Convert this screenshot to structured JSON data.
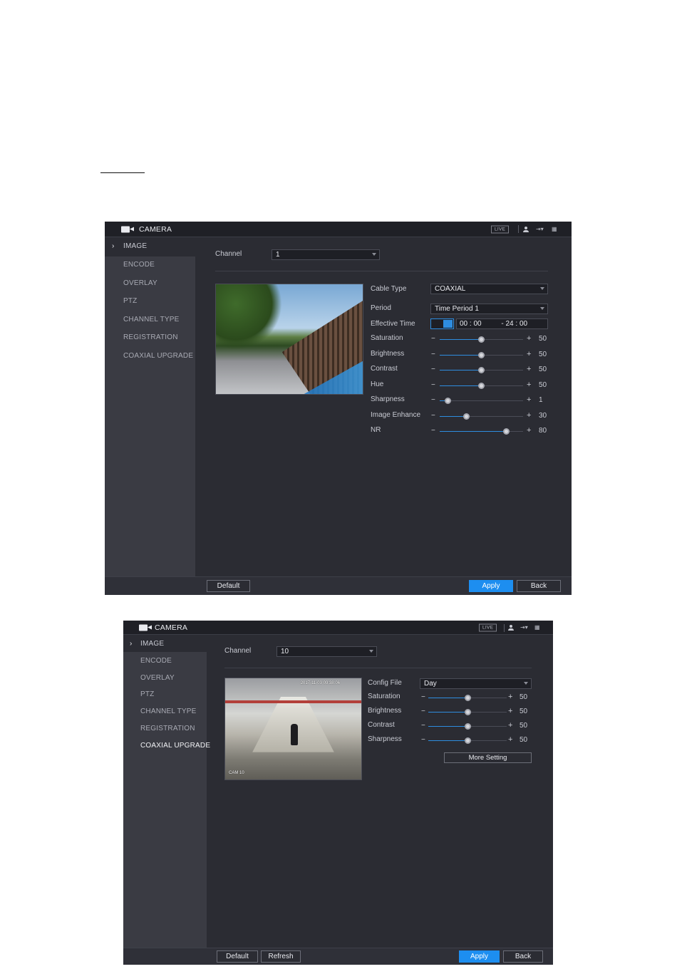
{
  "camera_window_1": {
    "title": "CAMERA",
    "live_label": "LIVE",
    "nav": [
      "IMAGE",
      "ENCODE",
      "OVERLAY",
      "PTZ",
      "CHANNEL TYPE",
      "REGISTRATION",
      "COAXIAL UPGRADE"
    ],
    "active_nav": "IMAGE",
    "channel_label": "Channel",
    "channel_value": "1",
    "cable_type_label": "Cable Type",
    "cable_type_value": "COAXIAL",
    "period_label": "Period",
    "period_value": "Time Period 1",
    "effective_time_label": "Effective Time",
    "effective_time_enabled": true,
    "start_time": "00 : 00",
    "end_time": "- 24 : 00",
    "sliders": [
      {
        "label": "Saturation",
        "value": 50,
        "fraction": 0.5
      },
      {
        "label": "Brightness",
        "value": 50,
        "fraction": 0.5
      },
      {
        "label": "Contrast",
        "value": 50,
        "fraction": 0.5
      },
      {
        "label": "Hue",
        "value": 50,
        "fraction": 0.5
      },
      {
        "label": "Sharpness",
        "value": 1,
        "fraction": 0.1
      },
      {
        "label": "Image Enhance",
        "value": 30,
        "fraction": 0.32
      },
      {
        "label": "NR",
        "value": 80,
        "fraction": 0.8
      }
    ],
    "buttons": {
      "default": "Default",
      "apply": "Apply",
      "back": "Back"
    },
    "accent_color": "#1d8ef0"
  },
  "camera_window_2": {
    "title": "CAMERA",
    "live_label": "LIVE",
    "nav": [
      "IMAGE",
      "ENCODE",
      "OVERLAY",
      "PTZ",
      "CHANNEL TYPE",
      "REGISTRATION",
      "COAXIAL UPGRADE"
    ],
    "active_nav": "IMAGE",
    "channel_label": "Channel",
    "channel_value": "10",
    "preview_timestamp": "2017-11-03 09:38:06",
    "preview_cam_label": "CAM 10",
    "config_file_label": "Config File",
    "config_file_value": "Day",
    "sliders": [
      {
        "label": "Saturation",
        "value": 50,
        "fraction": 0.5
      },
      {
        "label": "Brightness",
        "value": 50,
        "fraction": 0.5
      },
      {
        "label": "Contrast",
        "value": 50,
        "fraction": 0.5
      },
      {
        "label": "Sharpness",
        "value": 50,
        "fraction": 0.5
      }
    ],
    "more_setting_label": "More Setting",
    "buttons": {
      "default": "Default",
      "refresh": "Refresh",
      "apply": "Apply",
      "back": "Back"
    },
    "accent_color": "#1d8ef0"
  },
  "icons": [
    "camera-icon",
    "user-icon",
    "logout-icon",
    "grid-icon",
    "chevron-right-icon",
    "caret-down-icon"
  ]
}
